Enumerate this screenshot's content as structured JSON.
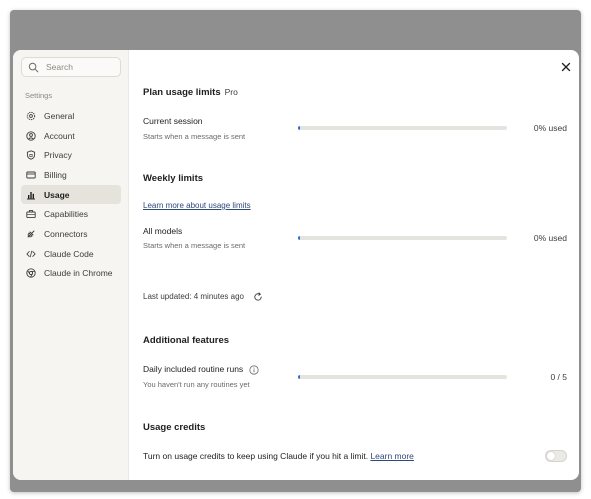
{
  "search": {
    "placeholder": "Search"
  },
  "sidebar": {
    "section_label": "Settings",
    "items": [
      {
        "label": "General",
        "icon": "gear-icon"
      },
      {
        "label": "Account",
        "icon": "user-circle-icon"
      },
      {
        "label": "Privacy",
        "icon": "shield-icon"
      },
      {
        "label": "Billing",
        "icon": "credit-card-icon"
      },
      {
        "label": "Usage",
        "icon": "bar-chart-icon",
        "active": true
      },
      {
        "label": "Capabilities",
        "icon": "briefcase-icon"
      },
      {
        "label": "Connectors",
        "icon": "plug-icon"
      },
      {
        "label": "Claude Code",
        "icon": "code-icon"
      },
      {
        "label": "Claude in Chrome",
        "icon": "globe-icon"
      }
    ]
  },
  "plan": {
    "title": "Plan usage limits",
    "badge": "Pro",
    "session_label": "Current session",
    "session_sub": "Starts when a message is sent",
    "session_value": "0% used",
    "session_progress": 0
  },
  "weekly": {
    "title": "Weekly limits",
    "learn_more": "Learn more about usage limits",
    "all_models_label": "All models",
    "all_models_sub": "Starts when a message is sent",
    "all_models_value": "0% used",
    "all_models_progress": 0,
    "last_updated": "Last updated: 4 minutes ago"
  },
  "additional": {
    "title": "Additional features",
    "routine_label": "Daily included routine runs",
    "routine_sub": "You haven't run any routines yet",
    "routine_value": "0 / 5",
    "routine_progress": 0
  },
  "credits": {
    "title": "Usage credits",
    "text": "Turn on usage credits to keep using Claude if you hit a limit.",
    "learn_more": "Learn more",
    "enabled": false
  },
  "colors": {
    "accent": "#2c6bc6",
    "sidebar_bg": "#f6f5f2",
    "active_item_bg": "#e6e3dc",
    "backdrop": "#8f8f8f"
  }
}
